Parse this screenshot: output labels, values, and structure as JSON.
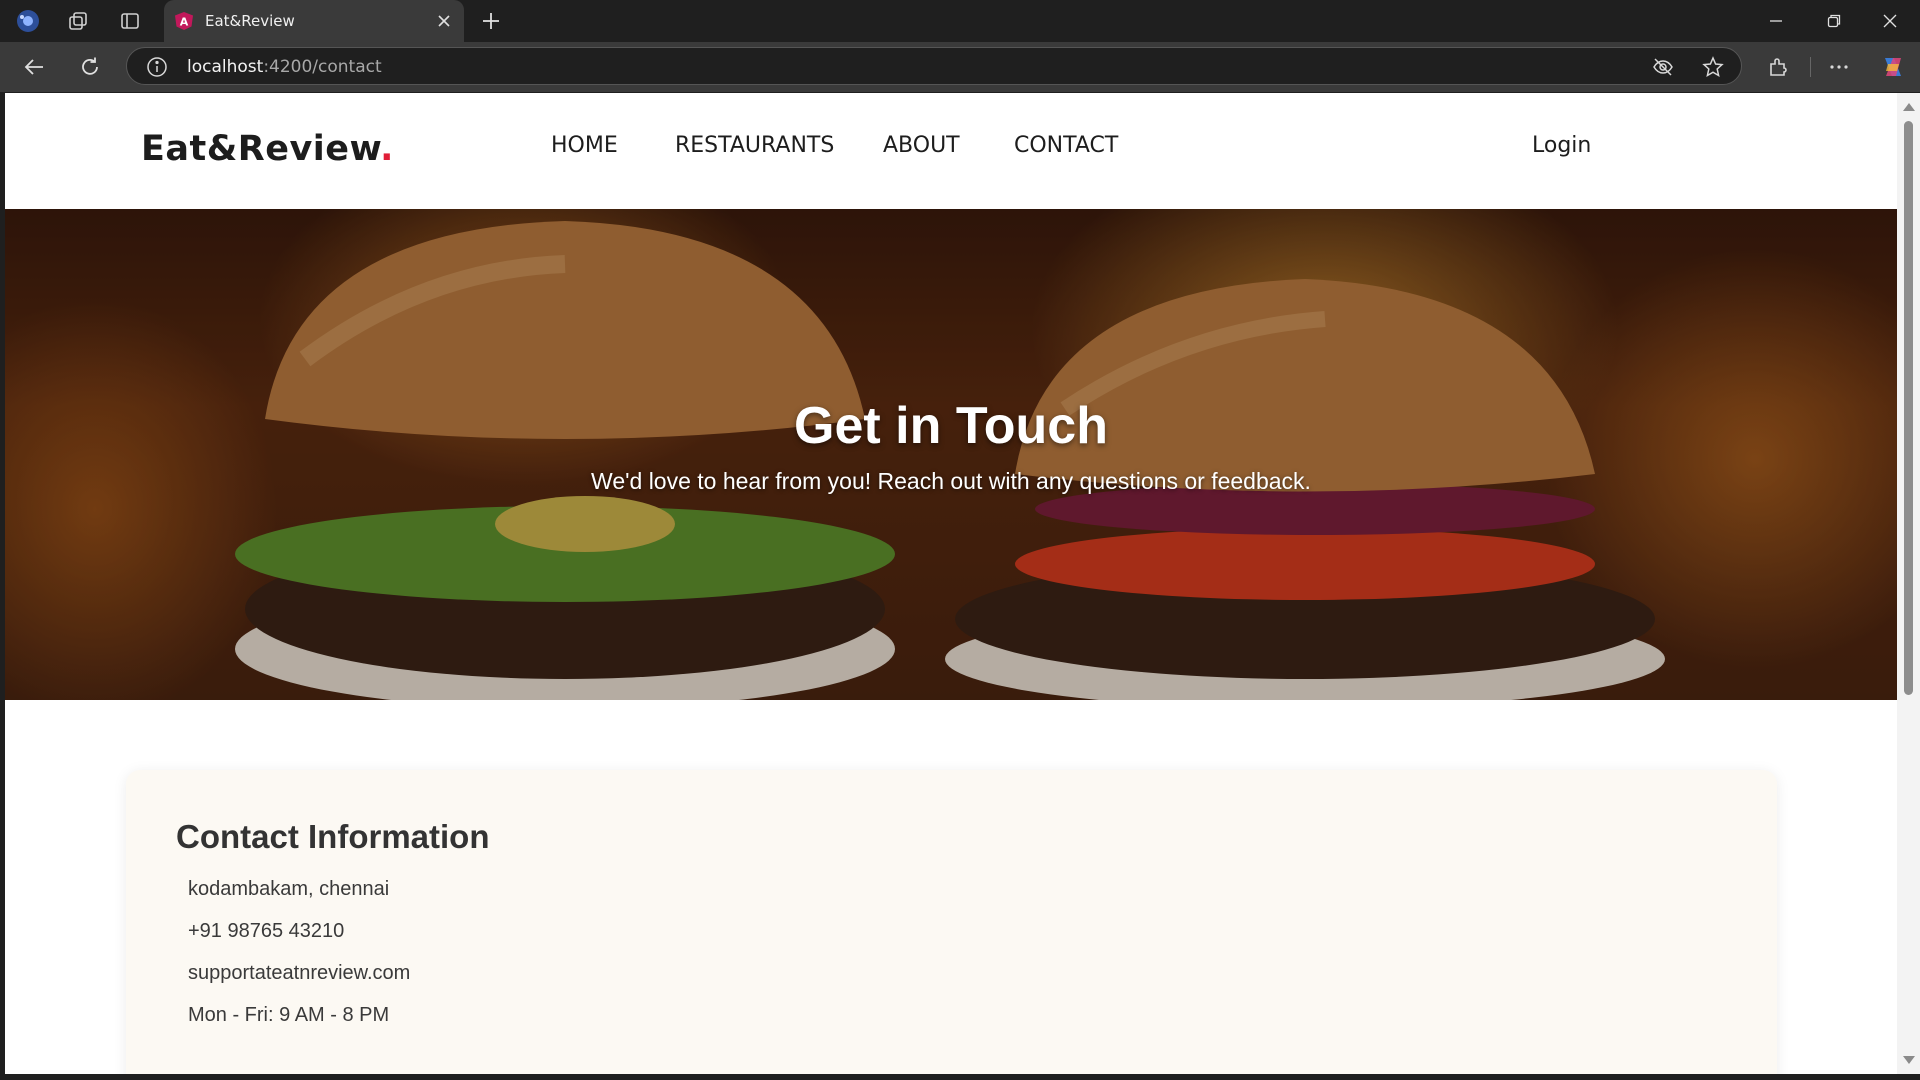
{
  "browser": {
    "tab_title": "Eat&Review",
    "url_host": "localhost",
    "url_path": ":4200/contact"
  },
  "site": {
    "logo_text": "Eat&Review",
    "logo_dot": ".",
    "brand_accent": "#e01e37",
    "nav": [
      "HOME",
      "RESTAURANTS",
      "ABOUT",
      "CONTACT"
    ],
    "login_label": "Login"
  },
  "hero": {
    "title": "Get in Touch",
    "subtitle": "We'd love to hear from you! Reach out with any questions or feedback."
  },
  "contact": {
    "title": "Contact Information",
    "address": "kodambakam, chennai",
    "phone": "+91 98765 43210",
    "email": "supportateatnreview.com",
    "hours": "Mon - Fri: 9 AM - 8 PM"
  }
}
